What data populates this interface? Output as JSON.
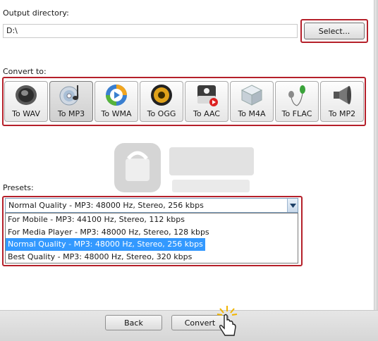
{
  "output": {
    "label": "Output directory:",
    "directory_value": "D:\\",
    "select_label": "Select..."
  },
  "convert": {
    "label": "Convert to:",
    "formats": [
      {
        "label": "To WAV",
        "icon": "speaker-icon",
        "selected": false
      },
      {
        "label": "To MP3",
        "icon": "cd-music-icon",
        "selected": true
      },
      {
        "label": "To WMA",
        "icon": "media-player-icon",
        "selected": false
      },
      {
        "label": "To OGG",
        "icon": "ogg-speaker-icon",
        "selected": false
      },
      {
        "label": "To AAC",
        "icon": "apple-device-icon",
        "selected": false
      },
      {
        "label": "To M4A",
        "icon": "cube-icon",
        "selected": false
      },
      {
        "label": "To FLAC",
        "icon": "earphones-icon",
        "selected": false
      },
      {
        "label": "To MP2",
        "icon": "loudspeaker-icon",
        "selected": false
      }
    ]
  },
  "presets": {
    "label": "Presets:",
    "selected_value": "Normal Quality - MP3: 48000 Hz, Stereo, 256 kbps",
    "options": [
      "For Mobile - MP3: 44100 Hz, Stereo, 112 kbps",
      "For Media Player - MP3: 48000 Hz, Stereo, 128 kbps",
      "Normal Quality - MP3: 48000 Hz, Stereo, 256 kbps",
      "Best Quality - MP3: 48000 Hz, Stereo, 320 kbps"
    ],
    "highlighted_index": 2
  },
  "footer": {
    "back_label": "Back",
    "convert_label": "Convert"
  },
  "colors": {
    "highlight_box": "#b5202a",
    "selection": "#3399ff"
  }
}
